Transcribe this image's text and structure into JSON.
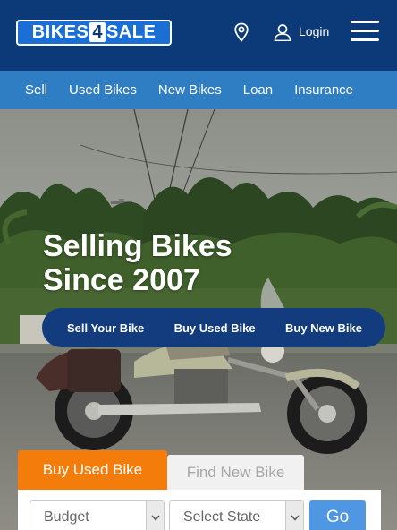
{
  "header": {
    "logo_part1": "BIKES",
    "logo_part2": "4",
    "logo_part3": "SALE",
    "login_label": "Login",
    "icons": [
      "location-pin-icon",
      "user-icon",
      "hamburger-menu-icon"
    ]
  },
  "nav": {
    "items": [
      "Sell",
      "Used Bikes",
      "New Bikes",
      "Loan",
      "Insurance"
    ]
  },
  "hero": {
    "headline_line1": "Selling Bikes",
    "headline_line2": "Since 2007",
    "actions": [
      "Sell Your Bike",
      "Buy Used Bike",
      "Buy New Bike"
    ]
  },
  "search": {
    "tabs": [
      "Buy Used Bike",
      "Find New Bike"
    ],
    "active_tab": "Buy Used Bike",
    "budget_placeholder": "Budget",
    "state_placeholder": "Select State",
    "go_label": "Go"
  },
  "colors": {
    "header_bg": "#0c3a79",
    "nav_bg": "#2f7ec4",
    "logo_bg": "#1b6fd4",
    "action_bar_bg": "#123c7d",
    "active_tab_bg": "#f47c0a",
    "go_button_bg": "#4f97e3"
  }
}
